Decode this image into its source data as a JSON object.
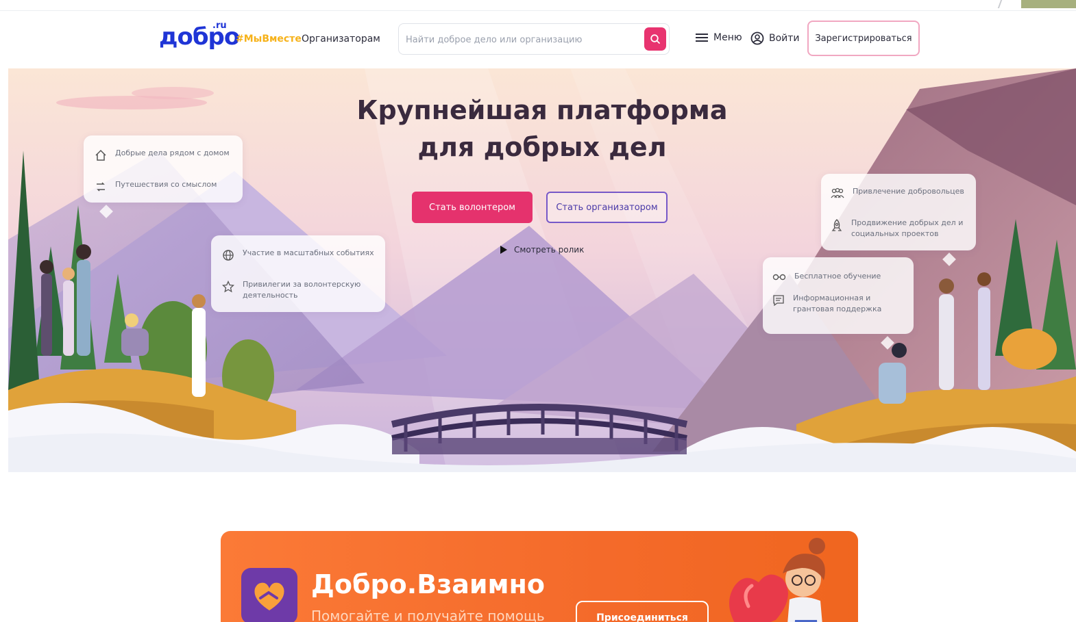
{
  "top_strip": {
    "text": ""
  },
  "header": {
    "logo_text": "добро",
    "logo_suffix": ".ru",
    "hashtag": "#МыВместе",
    "organizers_link": "Организаторам",
    "search_placeholder": "Найти доброе дело или организацию",
    "menu_label": "Меню",
    "login_label": "Войти",
    "register_label": "Зарегистрироваться"
  },
  "hero": {
    "title_line1": "Крупнейшая платформа",
    "title_line2": "для добрых дел",
    "volunteer_button": "Стать волонтером",
    "organizer_button": "Стать организатором",
    "watch_video": "Смотреть ролик",
    "card_left_top": [
      {
        "icon": "home-icon",
        "text": "Добрые дела рядом с домом"
      },
      {
        "icon": "route-icon",
        "text": "Путешествия со смыслом"
      }
    ],
    "card_left_mid": [
      {
        "icon": "globe-icon",
        "text": "Участие в масштабных событиях"
      },
      {
        "icon": "star-icon",
        "text": "Привилегии за волонтерскую деятельность"
      }
    ],
    "card_right_top": [
      {
        "icon": "people-icon",
        "text": "Привлечение добровольцев"
      },
      {
        "icon": "rocket-icon",
        "text": "Продвижение добрых дел и социальных проектов"
      }
    ],
    "card_right_mid": [
      {
        "icon": "glasses-icon",
        "text": "Бесплатное обучение"
      },
      {
        "icon": "message-icon",
        "text": "Информационная и грантовая поддержка"
      }
    ]
  },
  "promo": {
    "title": "Добро.Взаимно",
    "subtitle": "Помогайте и получайте помощь",
    "join_button": "Присоединиться"
  },
  "colors": {
    "brand_blue": "#1f35d6",
    "accent_pink": "#e5326d",
    "accent_purple": "#7658c8",
    "hashtag_yellow": "#f6b21a",
    "promo_orange": "#f46a2a"
  }
}
